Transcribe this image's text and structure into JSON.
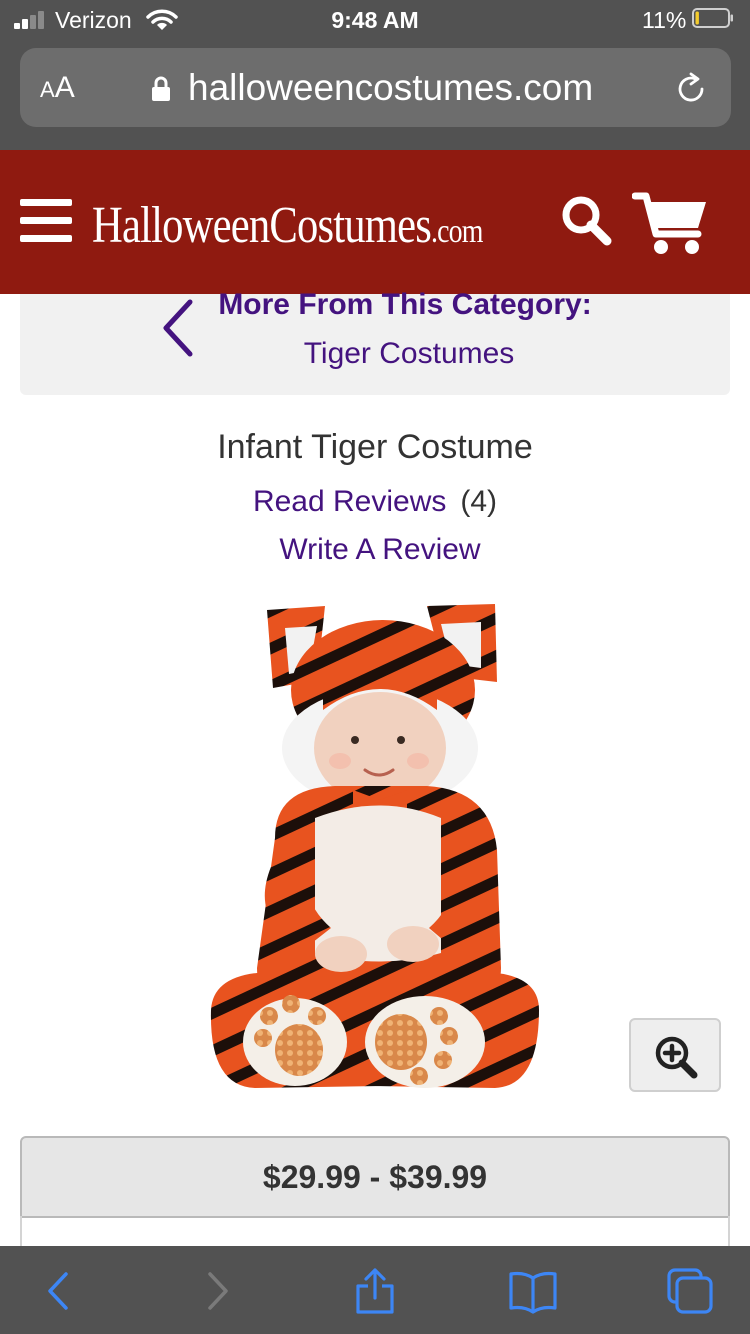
{
  "status_bar": {
    "carrier": "Verizon",
    "time": "9:48 AM",
    "battery_percent": "11%",
    "battery_level": 0.11
  },
  "browser": {
    "text_size_label_small": "A",
    "text_size_label_large": "A",
    "url": "halloweencostumes.com"
  },
  "site": {
    "logo_text": "HalloweenCostumes",
    "logo_suffix": ".com",
    "header_color": "#8f1a10"
  },
  "category": {
    "title": "More From This Category:",
    "link": "Tiger Costumes"
  },
  "product": {
    "name": "Infant Tiger Costume",
    "read_reviews_label": "Read Reviews",
    "review_count": "(4)",
    "write_review_label": "Write A Review",
    "price_range": "$29.99 - $39.99"
  },
  "icons": {
    "menu": "hamburger-icon",
    "search": "search-icon",
    "cart": "cart-icon",
    "back": "chevron-left-icon",
    "zoom": "zoom-in-icon",
    "toolbar": [
      "back-arrow-icon",
      "forward-arrow-icon",
      "share-icon",
      "bookmarks-icon",
      "tabs-icon"
    ]
  },
  "colors": {
    "link": "#44137f",
    "toolbar_accent": "#3d86f5"
  }
}
